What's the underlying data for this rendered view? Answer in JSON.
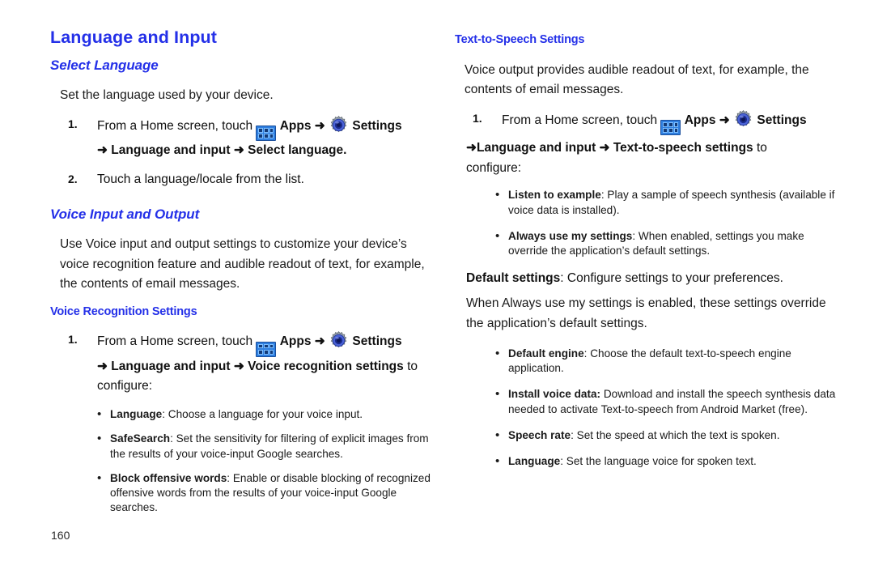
{
  "document": {
    "page_number": "160",
    "accent_color": "#2430e8",
    "icons": {
      "apps": "apps-grid-icon",
      "settings": "gear-icon"
    }
  },
  "left_column": {
    "title": "Language and Input",
    "section_select_language": {
      "heading": "Select Language",
      "intro": "Set the language used by your device.",
      "steps": [
        {
          "number": "1.",
          "text_before_apps": "From a Home screen, touch",
          "apps_label": "Apps",
          "arrow": "➜",
          "settings_label": "Settings",
          "continuation": "➜ Language and input ➜ Select language."
        },
        {
          "number": "2.",
          "text": "Touch a language/locale from the list."
        }
      ]
    },
    "section_voice_input_output": {
      "heading": "Voice Input and Output",
      "intro": "Use Voice input and output settings to customize your device’s voice recognition feature and audible readout of text, for example, the contents of email messages."
    },
    "section_voice_recognition": {
      "heading": "Voice Recognition Settings",
      "step": {
        "number": "1.",
        "text_before_apps": "From a Home screen, touch",
        "apps_label": "Apps",
        "arrow": "➜",
        "settings_label": "Settings",
        "continuation_bold": "➜ Language and input ➜ Voice recognition settings",
        "continuation_tail": " to",
        "configure": "configure:"
      },
      "bullets": [
        {
          "term": "Language",
          "desc": ": Choose a language for your voice input."
        },
        {
          "term": "SafeSearch",
          "desc": ": Set the sensitivity for filtering of explicit images from the results of your voice-input Google searches."
        },
        {
          "term": "Block offensive words",
          "desc": ": Enable or disable blocking of recognized offensive words from the results of your voice-input Google searches."
        }
      ]
    }
  },
  "right_column": {
    "section_tts": {
      "heading": "Text-to-Speech Settings",
      "intro": "Voice output provides audible readout of text, for example, the contents of email messages.",
      "step": {
        "number": "1.",
        "text_before_apps": "From a Home screen, touch",
        "apps_label": "Apps",
        "arrow": "➜",
        "settings_label": "Settings",
        "continuation_bold": "➜Language and input ➜ Text-to-speech settings",
        "continuation_tail": " to",
        "configure": "configure:"
      },
      "bullets_top": [
        {
          "term": "Listen to example",
          "desc": ": Play a sample of speech synthesis (available if voice data is installed)."
        },
        {
          "term": "Always use my settings",
          "desc": ": When enabled, settings you make override the application’s default settings."
        }
      ],
      "default_settings_line": {
        "term": "Default settings",
        "desc": ": Configure settings to your preferences."
      },
      "override_paragraph": "When Always use my settings is enabled, these settings override the application’s default settings.",
      "bullets_bottom": [
        {
          "term": "Default engine",
          "desc": ": Choose the default text-to-speech engine application."
        },
        {
          "term": "Install voice data:",
          "desc": " Download and install the speech synthesis data needed to activate Text-to-speech from Android Market (free)."
        },
        {
          "term": "Speech rate",
          "desc": ": Set the speed at which the text is spoken."
        },
        {
          "term": "Language",
          "desc": ": Set the language voice for spoken text."
        }
      ]
    }
  }
}
